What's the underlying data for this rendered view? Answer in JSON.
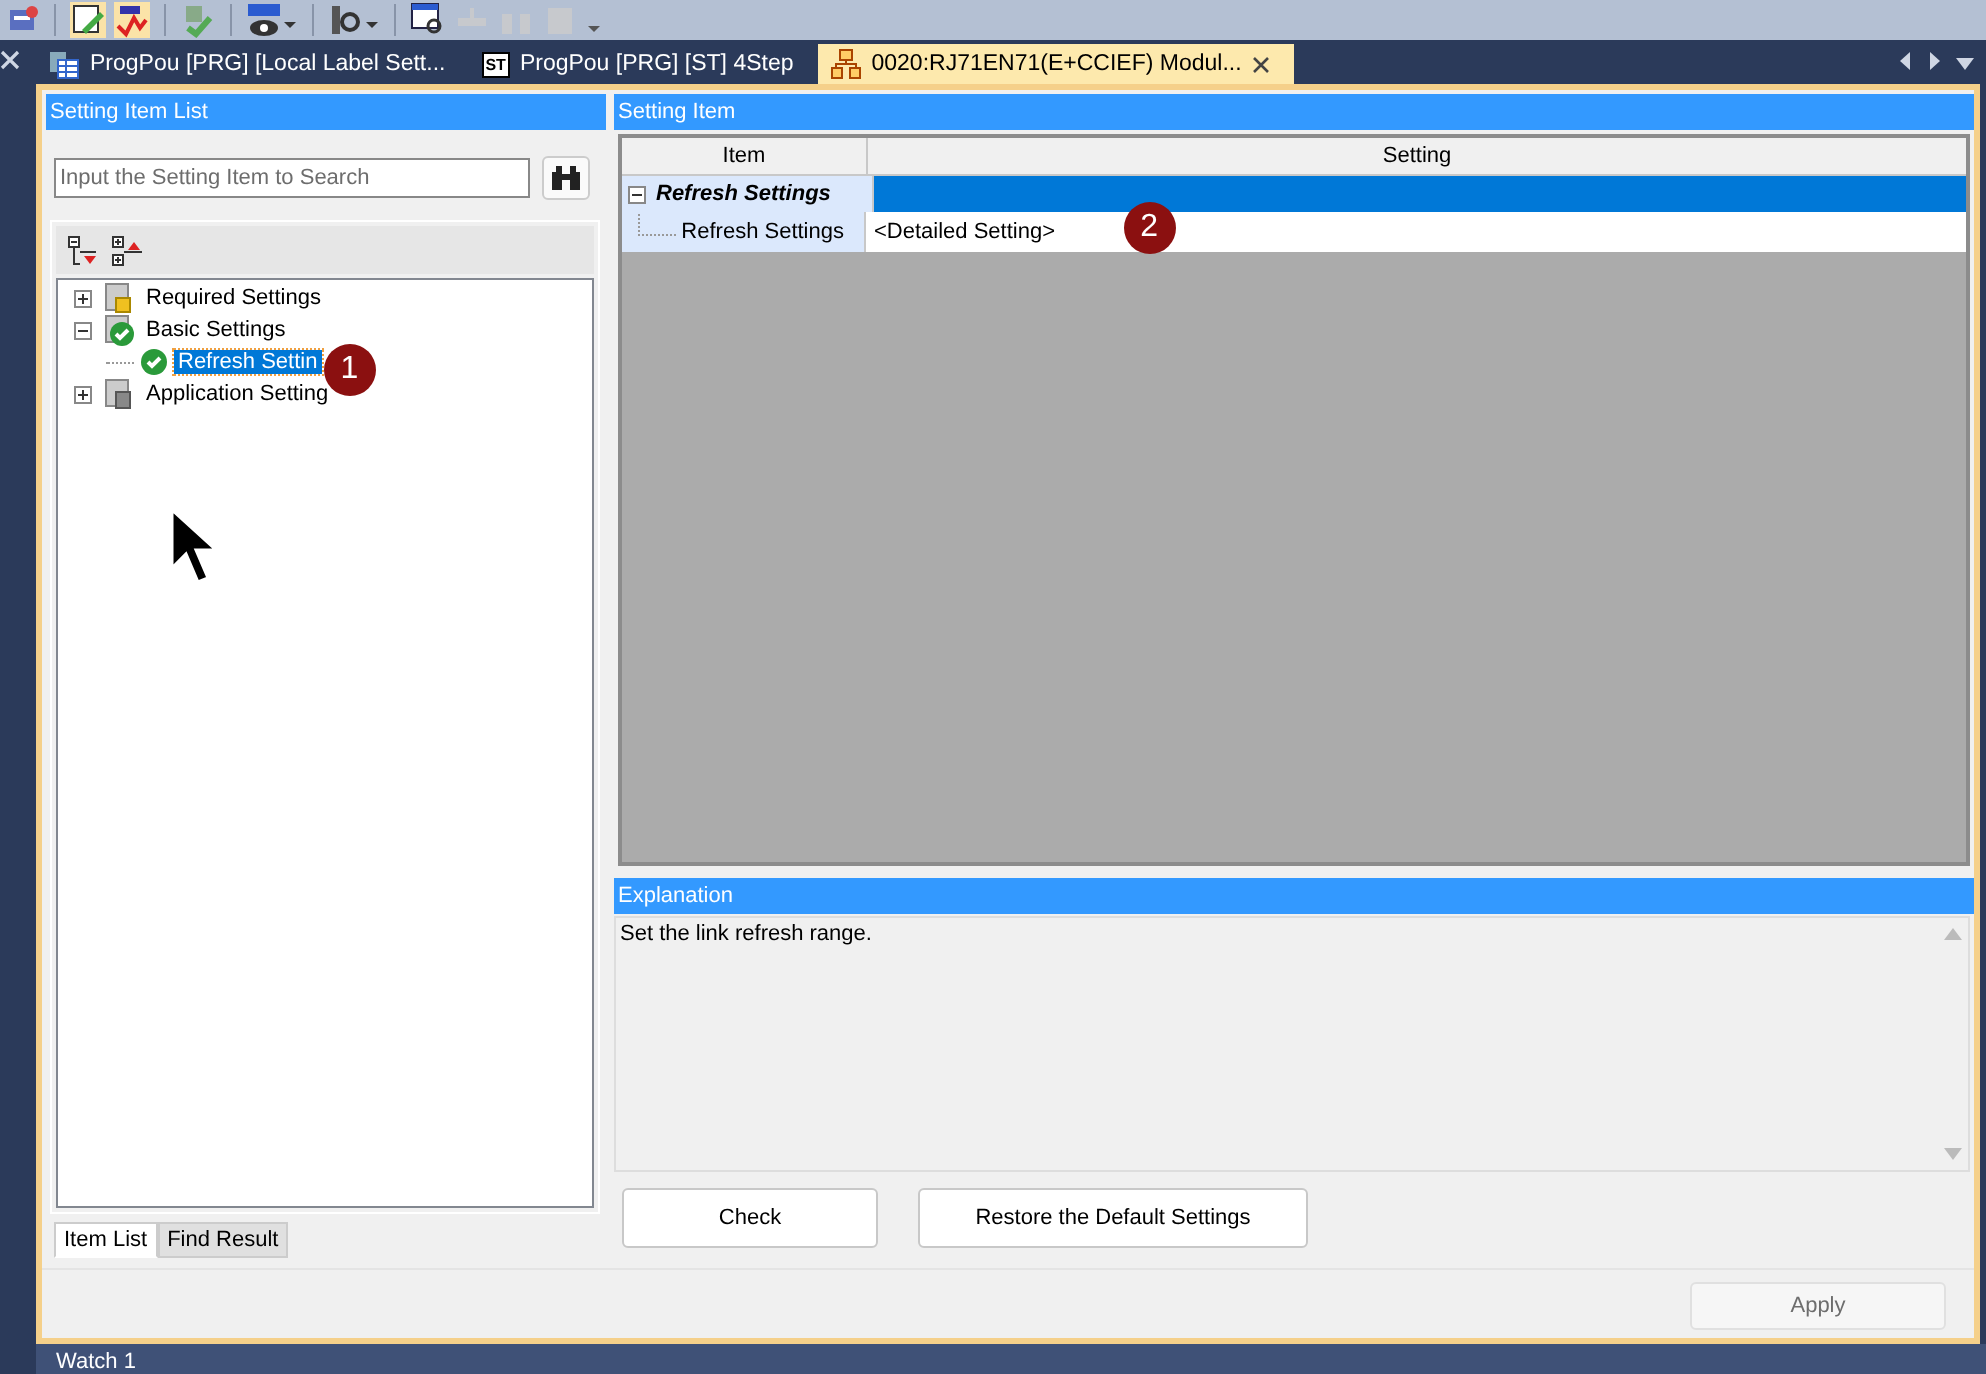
{
  "doc_tabs": [
    {
      "label": "ProgPou [PRG] [Local Label Sett...",
      "kind": "table",
      "selected": false
    },
    {
      "label": "ProgPou [PRG] [ST] 4Step",
      "kind": "st",
      "selected": false
    },
    {
      "label": "0020:RJ71EN71(E+CCIEF) Modul...",
      "kind": "module",
      "selected": true
    }
  ],
  "st_badge": "ST",
  "left_panel": {
    "title": "Setting Item List",
    "search": {
      "placeholder": "Input the Setting Item to Search"
    },
    "tree": [
      {
        "label": "Required Settings",
        "kind": "required",
        "expanded": false,
        "selected": false
      },
      {
        "label": "Basic Settings",
        "kind": "ok",
        "expanded": true,
        "selected": false,
        "children": [
          {
            "label": "Refresh Settin",
            "kind": "check",
            "selected": true,
            "callout": "1"
          }
        ]
      },
      {
        "label": "Application Setting",
        "kind": "application",
        "expanded": false,
        "selected": false
      }
    ],
    "tabs": [
      {
        "label": "Item List",
        "selected": true
      },
      {
        "label": "Find Result",
        "selected": false
      }
    ]
  },
  "right_panel": {
    "title": "Setting Item",
    "columns": [
      "Item",
      "Setting"
    ],
    "groups": [
      {
        "label": "Refresh Settings",
        "expanded": true,
        "selected": true,
        "rows": [
          {
            "item": "Refresh Settings",
            "setting": "<Detailed Setting>",
            "callout": "2"
          }
        ]
      }
    ],
    "explanation": {
      "title": "Explanation",
      "text": "Set the link refresh range."
    },
    "buttons": [
      "Check",
      "Restore the Default Settings"
    ]
  },
  "apply": {
    "label": "Apply",
    "disabled": true
  },
  "bottom_panel": {
    "title": "Watch 1"
  }
}
